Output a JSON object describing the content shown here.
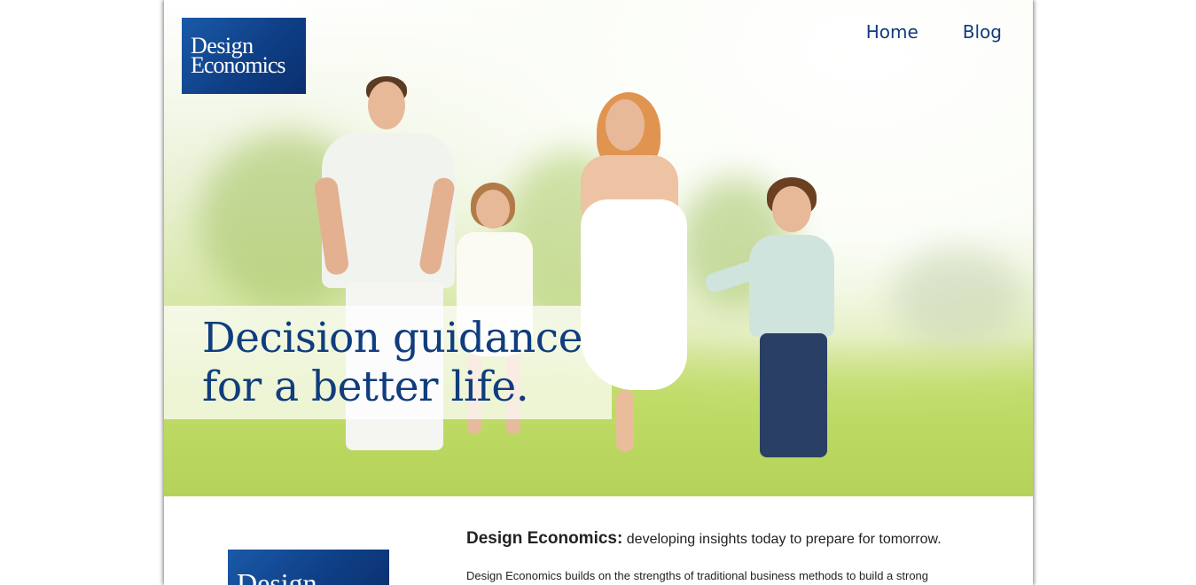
{
  "header": {
    "logo_line1": "Design",
    "logo_line2": "Economics",
    "nav": [
      {
        "label": "Home"
      },
      {
        "label": "Blog"
      }
    ]
  },
  "hero": {
    "tagline_line1": "Decision guidance",
    "tagline_line2": "for a better life."
  },
  "intro": {
    "logo_text": "Design",
    "heading_bold": "Design Economics:",
    "heading_rest": " developing insights today to prepare for tomorrow.",
    "body": "Design Economics builds on the strengths of traditional business methods to build a strong"
  },
  "colors": {
    "brand_blue": "#0f3d7d",
    "logo_gradient_start": "#1a5aa8",
    "logo_gradient_end": "#0a2f6e"
  }
}
